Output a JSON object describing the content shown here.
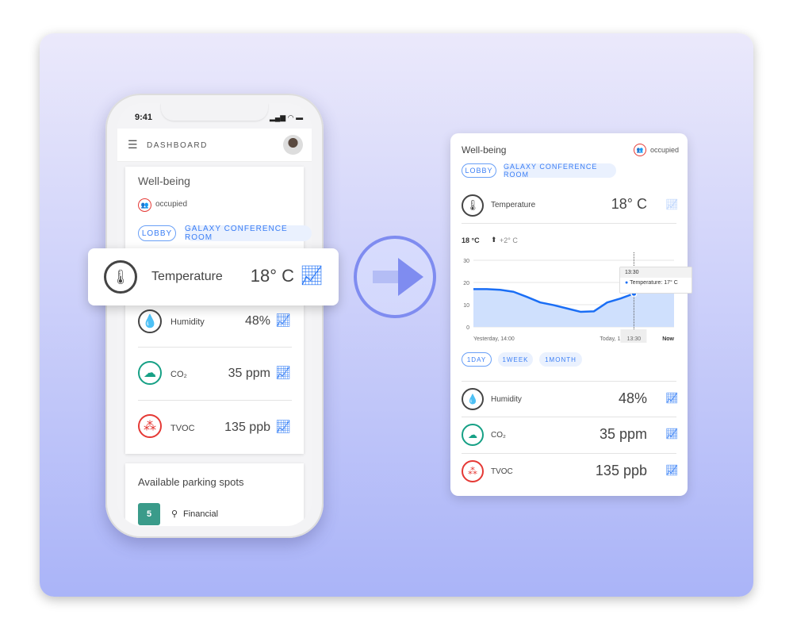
{
  "phone": {
    "status_time": "9:41",
    "header_title": "DASHBOARD",
    "wellbeing_title": "Well-being",
    "occupancy": "occupied",
    "locations": [
      "LOBBY",
      "GALAXY CONFERENCE ROOM"
    ],
    "metrics": [
      {
        "name": "Temperature",
        "value": "18° C",
        "icon": "thermometer-icon"
      },
      {
        "name": "Humidity",
        "value": "48%",
        "icon": "droplet-icon"
      },
      {
        "name": "CO₂",
        "value": "35 ppm",
        "icon": "cloud-icon"
      },
      {
        "name": "TVOC",
        "value": "135 ppb",
        "icon": "molecule-icon"
      }
    ],
    "parking_title": "Available parking spots",
    "parking_count": "5",
    "parking_location": "Financial"
  },
  "detail": {
    "title": "Well-being",
    "occupancy": "occupied",
    "locations": [
      "LOBBY",
      "GALAXY CONFERENCE ROOM"
    ],
    "temperature": {
      "name": "Temperature",
      "value": "18° C",
      "current": "18 °C",
      "change": "+2° C"
    },
    "ranges": [
      "1DAY",
      "1WEEK",
      "1MONTH"
    ],
    "selected_range": "1DAY",
    "metrics": [
      {
        "name": "Humidity",
        "value": "48%"
      },
      {
        "name": "CO₂",
        "value": "35 ppm"
      },
      {
        "name": "TVOC",
        "value": "135 ppb"
      }
    ]
  },
  "colors": {
    "accent": "#1a6ef5",
    "occupied": "#e53935",
    "co2": "#16a085",
    "tvoc": "#e53935"
  },
  "chart_data": {
    "type": "area",
    "series": [
      {
        "name": "Temperature",
        "values": [
          17,
          17,
          16.7,
          15.8,
          13.5,
          11,
          9.8,
          8.3,
          6.8,
          7,
          11,
          12.8,
          15,
          16.5,
          16,
          16
        ]
      }
    ],
    "y_ticks": [
      "0",
      "10",
      "20",
      "30"
    ],
    "ylim": [
      0,
      30
    ],
    "x_labels": [
      "Yesterday, 14:00",
      "Today, 13:00",
      "Now"
    ],
    "cursor_label": "13:30",
    "tooltip": {
      "title": "13:30",
      "text": "Temperature: 17° C"
    },
    "grid": true
  }
}
